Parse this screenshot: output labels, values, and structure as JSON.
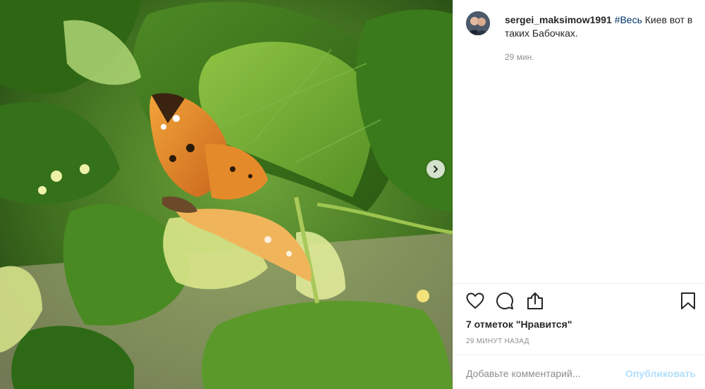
{
  "post": {
    "username": "sergei_maksimow1991",
    "hashtag": "#Весь",
    "caption_rest": "Киев вот в таких Бабочках.",
    "caption_time": "29 мин.",
    "likes": "7 отметок \"Нравится\"",
    "posted_ago": "29 минут назад"
  },
  "actions": {
    "like_icon": "heart-icon",
    "comment_icon": "comment-icon",
    "share_icon": "share-icon",
    "save_icon": "bookmark-icon"
  },
  "comment_box": {
    "placeholder": "Добавьте комментарий...",
    "publish_label": "Опубликовать"
  },
  "photo": {
    "next_icon": "chevron-right-icon"
  },
  "colors": {
    "text": "#262626",
    "muted": "#8e8e8e",
    "hashtag": "#003569",
    "publish_disabled": "#b2dffc"
  }
}
